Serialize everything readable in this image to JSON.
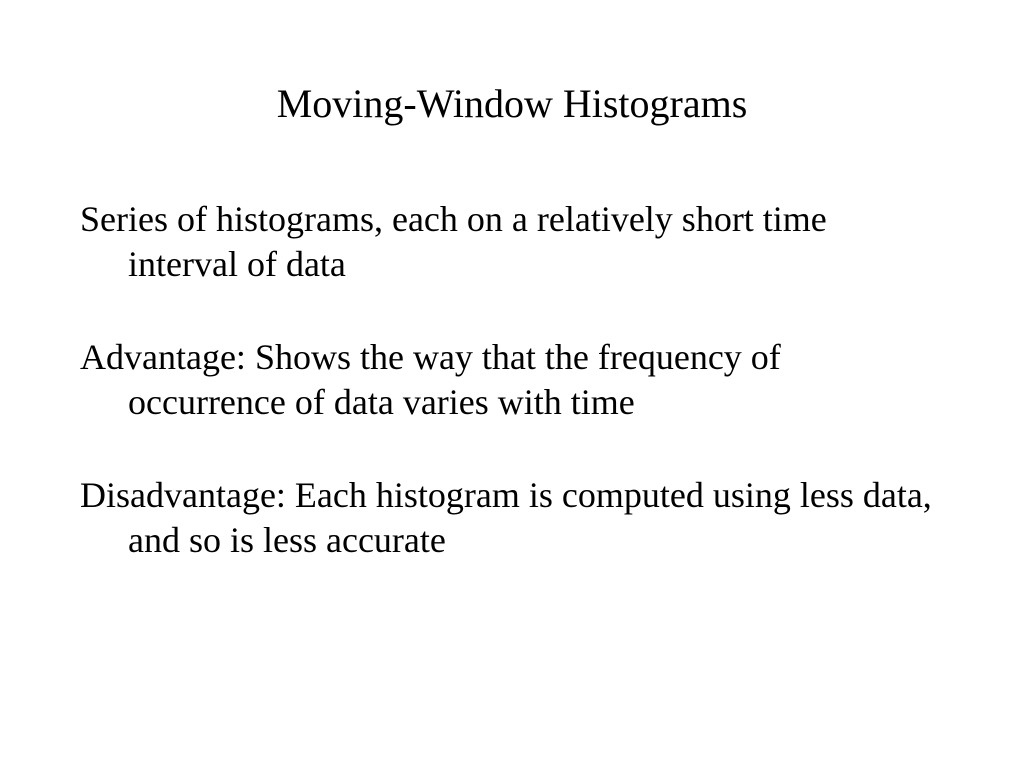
{
  "slide": {
    "title": "Moving-Window Histograms",
    "paragraphs": [
      "Series of histograms, each on a relatively short time interval of data",
      "Advantage:  Shows the way that the frequency of occurrence of data varies with time",
      "Disadvantage:  Each histogram is computed using less data, and so is less accurate"
    ]
  }
}
